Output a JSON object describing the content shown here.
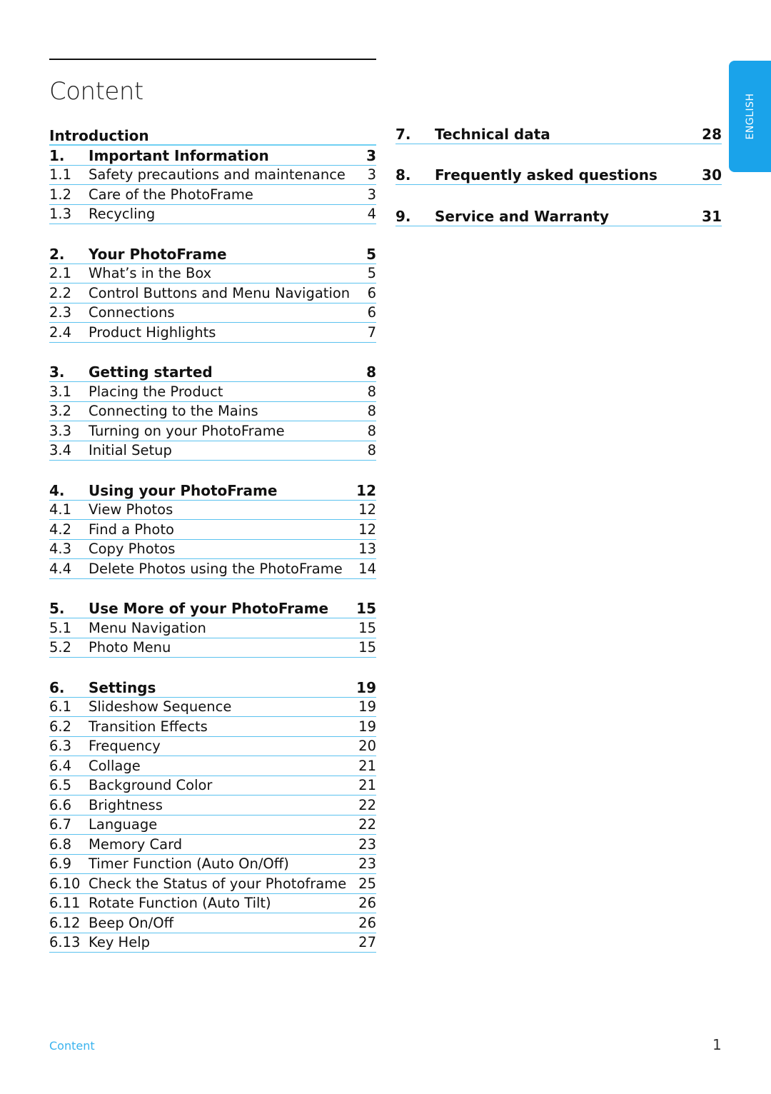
{
  "page": {
    "title": "Content",
    "language_tab": "ENGLISH",
    "footer_label": "Content",
    "page_number": "1"
  },
  "toc": {
    "intro_heading": "Introduction",
    "left_sections": [
      {
        "chapter": {
          "num": "1.",
          "title": "Important Information",
          "page": "3"
        },
        "items": [
          {
            "num": "1.1",
            "title": "Safety precautions and maintenance",
            "page": "3"
          },
          {
            "num": "1.2",
            "title": "Care of the PhotoFrame",
            "page": "3"
          },
          {
            "num": "1.3",
            "title": "Recycling",
            "page": "4"
          }
        ]
      },
      {
        "chapter": {
          "num": "2.",
          "title": "Your PhotoFrame",
          "page": "5"
        },
        "items": [
          {
            "num": "2.1",
            "title": "What’s in the Box",
            "page": "5"
          },
          {
            "num": "2.2",
            "title": "Control Buttons and Menu Navigation",
            "page": "6"
          },
          {
            "num": "2.3",
            "title": "Connections",
            "page": "6"
          },
          {
            "num": "2.4",
            "title": "Product Highlights",
            "page": "7"
          }
        ]
      },
      {
        "chapter": {
          "num": "3.",
          "title": "Getting started",
          "page": "8"
        },
        "items": [
          {
            "num": "3.1",
            "title": "Placing the Product",
            "page": "8"
          },
          {
            "num": "3.2",
            "title": "Connecting to the Mains",
            "page": "8"
          },
          {
            "num": "3.3",
            "title": "Turning on your PhotoFrame",
            "page": "8"
          },
          {
            "num": "3.4",
            "title": "Initial Setup",
            "page": "8"
          }
        ]
      },
      {
        "chapter": {
          "num": "4.",
          "title": "Using your PhotoFrame",
          "page": "12"
        },
        "items": [
          {
            "num": "4.1",
            "title": "View Photos",
            "page": "12"
          },
          {
            "num": "4.2",
            "title": "Find a Photo",
            "page": "12"
          },
          {
            "num": "4.3",
            "title": "Copy Photos",
            "page": "13"
          },
          {
            "num": "4.4",
            "title": "Delete Photos using the PhotoFrame",
            "page": "14"
          }
        ]
      },
      {
        "chapter": {
          "num": "5.",
          "title": "Use More of your PhotoFrame",
          "page": "15"
        },
        "items": [
          {
            "num": "5.1",
            "title": "Menu Navigation",
            "page": "15"
          },
          {
            "num": "5.2",
            "title": "Photo Menu",
            "page": "15"
          }
        ]
      },
      {
        "chapter": {
          "num": "6.",
          "title": "Settings",
          "page": "19"
        },
        "items": [
          {
            "num": "6.1",
            "title": "Slideshow Sequence",
            "page": "19"
          },
          {
            "num": "6.2",
            "title": "Transition Effects",
            "page": "19"
          },
          {
            "num": "6.3",
            "title": "Frequency",
            "page": "20"
          },
          {
            "num": "6.4",
            "title": "Collage",
            "page": "21"
          },
          {
            "num": "6.5",
            "title": "Background Color",
            "page": "21"
          },
          {
            "num": "6.6",
            "title": "Brightness",
            "page": "22"
          },
          {
            "num": "6.7",
            "title": "Language",
            "page": "22"
          },
          {
            "num": "6.8",
            "title": "Memory Card",
            "page": "23"
          },
          {
            "num": "6.9",
            "title": "Timer Function (Auto On/Off)",
            "page": "23"
          },
          {
            "num": "6.10",
            "title": "Check the Status of your Photoframe",
            "page": "25"
          },
          {
            "num": "6.11",
            "title": "Rotate Function (Auto Tilt)",
            "page": "26"
          },
          {
            "num": "6.12",
            "title": "Beep On/Off",
            "page": "26"
          },
          {
            "num": "6.13",
            "title": "Key Help",
            "page": "27"
          }
        ]
      }
    ],
    "right_chapters": [
      {
        "num": "7.",
        "title": "Technical data",
        "page": "28"
      },
      {
        "num": "8.",
        "title": "Frequently asked questions",
        "page": "30"
      },
      {
        "num": "9.",
        "title": "Service and Warranty",
        "page": "31"
      }
    ]
  },
  "colors": {
    "accent": "#1aa3ea",
    "rule": "#5bc2ef",
    "footer_text": "#39b3ee"
  }
}
